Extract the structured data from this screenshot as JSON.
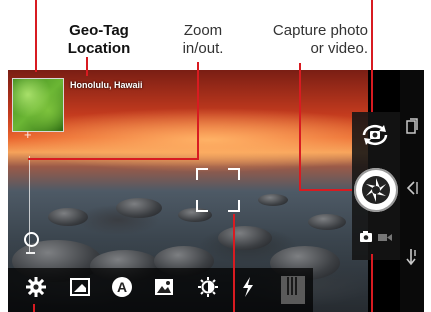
{
  "annotations": {
    "geotag": "Geo-Tag\nLocation",
    "zoom": "Zoom\nin/out.",
    "capture": "Capture photo\nor video."
  },
  "viewfinder": {
    "location_text": "Honolulu, Hawaii",
    "zoom_plus": "+"
  },
  "toolbar": {
    "icons": [
      "settings-icon",
      "picture-frame-icon",
      "auto-mode-icon",
      "scene-image-icon",
      "exposure-icon",
      "flash-icon",
      "panorama-icon"
    ]
  },
  "capture_panel": {
    "icons": [
      "switch-camera-icon",
      "shutter-button",
      "photo-video-toggle"
    ]
  },
  "navbar": {
    "icons": [
      "recent-apps-icon",
      "back-icon",
      "home-icon"
    ]
  },
  "colors": {
    "leader": "#d81b21",
    "toolbar_bg": "#000000",
    "sunset": "#e8602a"
  }
}
